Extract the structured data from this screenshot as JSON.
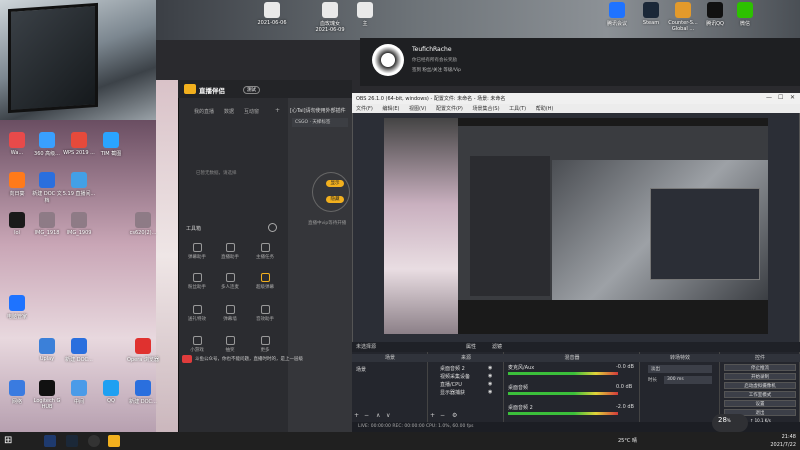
{
  "desktop": {
    "top_icons": [
      {
        "label": "2021-06-06",
        "color": "#e9e9e9"
      },
      {
        "label": "血玫瑰女 2021-06-09",
        "color": "#e9e9e9"
      },
      {
        "label": "主",
        "color": "#e9e9e9"
      },
      {
        "label": "腾讯会议",
        "color": "#1f73ff"
      },
      {
        "label": "Steam",
        "color": "#1b2838"
      },
      {
        "label": "Counter-S... Global ...",
        "color": "#e39a2b"
      },
      {
        "label": "腾讯QQ",
        "color": "#111111"
      },
      {
        "label": "微信",
        "color": "#2dc100"
      }
    ],
    "left_icons": [
      {
        "label": "Wa...",
        "color": "#e84a4a"
      },
      {
        "label": "360 高级...",
        "color": "#39a0ff"
      },
      {
        "label": "WPS 2019 ...",
        "color": "#e64a3b"
      },
      {
        "label": "TIM 截图",
        "color": "#2aa4ff"
      },
      {
        "label": "向日葵",
        "color": "#ff7a1a"
      },
      {
        "label": "新建 DOC 文档",
        "color": "#2a6fde"
      },
      {
        "label": "5.19 直播间...",
        "color": "#43a0e6"
      },
      {
        "label": "lol",
        "color": "#1a1a1a"
      },
      {
        "label": "IMG_1918",
        "color": "#8e7b86"
      },
      {
        "label": "IMG_1909",
        "color": "#8e7b86"
      },
      {
        "label": "cs620(2)...",
        "color": "#8e7b86"
      },
      {
        "label": "电脑管家",
        "color": "#1e73ff"
      },
      {
        "label": "Uplay",
        "color": "#3b80d9"
      },
      {
        "label": "新建 DOC...",
        "color": "#2a6fde"
      },
      {
        "label": "网络",
        "color": "#3a7be0"
      },
      {
        "label": "Logitech G HUB",
        "color": "#111111"
      },
      {
        "label": "中间",
        "color": "#4b9be8"
      },
      {
        "label": "QQ",
        "color": "#1ea0f2"
      },
      {
        "label": "新建 DOC...",
        "color": "#2a6fde"
      },
      {
        "label": "Opera 浏览器",
        "color": "#e0312f"
      }
    ]
  },
  "profile": {
    "name": "TeufichRache",
    "subtitle": "你已经有所有会长奖励",
    "right_text": "签到 粉丝/关注 等级/Vip"
  },
  "assistant": {
    "brand": "直播伴侣",
    "version": "测试",
    "tabs": [
      "我的直播",
      "数据",
      "互动窗"
    ],
    "notice": "[心Tai]请勿使用外部插件",
    "empty_hint": "已暂无数据，请选择",
    "game_tag": "CSGO · 天梯标签",
    "tools_title": "工具箱",
    "pill_1": "显示",
    "pill_2": "隐藏",
    "side_hint": "直播中vip等待开播",
    "tools": [
      "弹幕助手",
      "直播助手",
      "主播任务",
      "粉丝助手",
      "多人连麦",
      "超级弹幕",
      "送礼特效",
      "弹幕墙",
      "音效助手",
      "小游戏",
      "抽奖",
      "更多"
    ],
    "footer": "斗鱼公众号，你也不能问题，直播时时的，是上一层级"
  },
  "obs": {
    "title": "OBS 26.1.0 (64-bit, windows) - 配置文件: 未命名 - 场景: 未命名",
    "menu": [
      "文件(F)",
      "编辑(E)",
      "视图(V)",
      "配置文件(P)",
      "场景集合(S)",
      "工具(T)",
      "帮助(H)"
    ],
    "scene_bar": "未选择源",
    "props_label": "属性",
    "filters_label": "滤镜",
    "docks": {
      "scenes_title": "场景",
      "sources_title": "来源",
      "mixer_title": "混音器",
      "transitions_title": "转场特效",
      "controls_title": "控件"
    },
    "scenes": [
      "场景"
    ],
    "sources": [
      "桌面音频 2",
      "视频采集设备",
      "直播/CPU",
      "显示器捕获"
    ],
    "mixer": [
      {
        "name": "麦克风/Aux",
        "db": "-0.0 dB"
      },
      {
        "name": "桌面音频",
        "db": "0.0 dB"
      },
      {
        "name": "桌面音频 2",
        "db": "-2.0 dB"
      }
    ],
    "transition": {
      "type": "淡出",
      "duration_label": "时长",
      "duration": "300 ms"
    },
    "controls": [
      "停止推流",
      "开始录制",
      "启动虚拟摄像机",
      "工作室模式",
      "设置",
      "退出"
    ],
    "status": "LIVE: 00:00:00    REC: 00:00:00    CPU: 1.0%, 60.00 fps"
  },
  "overlay_speed": {
    "value": "28",
    "unit": "%",
    "net": "↑ 10.1 K/s"
  },
  "taskbar": {
    "weather": "25°C 晴",
    "time": "21:48",
    "date": "2021/7/22"
  }
}
